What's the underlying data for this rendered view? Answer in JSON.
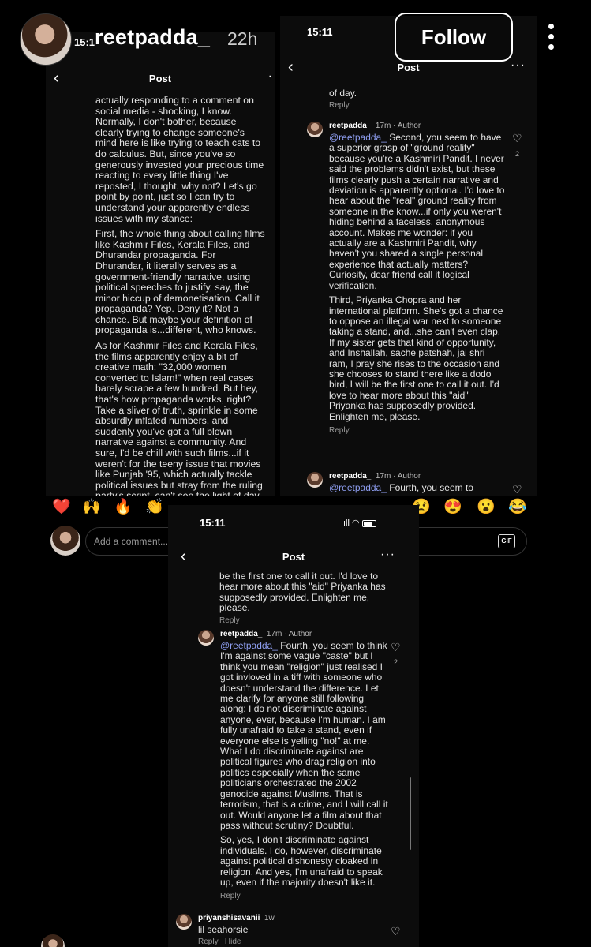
{
  "overlay": {
    "username": "reetpadda_",
    "time_ago": "22h",
    "follow_label": "Follow"
  },
  "screen1": {
    "time": "15:1",
    "nav_title": "Post",
    "paragraphs": [
      "actually responding to a comment on social media - shocking, I know. Normally, I don't bother, because clearly trying to change someone's mind here is like trying to teach cats to do calculus. But, since you've so generously invested your precious time reacting to every little thing I've reposted, I thought, why not? Let's go point by point, just so I can try to understand your apparently endless issues with my stance:",
      "First, the whole thing about calling films like Kashmir Files, Kerala Files, and Dhurandar propaganda. For Dhurandar, it literally serves as a government-friendly narrative, using political speeches to justify, say, the minor hiccup of demonetisation. Call it propaganda? Yep. Deny it? Not a chance. But maybe your definition of propaganda is...different, who knows.",
      "As for Kashmir Files and Kerala Files, the films apparently enjoy a bit of creative math: \"32,000 women converted to Islam!\" when real cases barely scrape a few hundred. But hey, that's how propaganda works, right? Take a sliver of truth, sprinkle in some absurdly inflated numbers, and suddenly you've got a full blown narrative against a community. And sure, I'd be chill with such films...if it weren't for the teeny issue that movies like Punjab '95, which actually tackle political issues but stray from the ruling party's script, can't see the light of day."
    ]
  },
  "screen2": {
    "time": "15:11",
    "nav_title": "Post",
    "top_fragment": "of day.",
    "reply_label": "Reply",
    "comment1": {
      "author": "reetpadda_",
      "meta": "17m · Author",
      "mention": "@reetpadda_",
      "like_count": "2",
      "paragraphs": [
        "Second, you seem to have a superior grasp of \"ground reality\" because you're a Kashmiri Pandit. I never said the problems didn't exist, but these films clearly push a certain narrative and deviation is apparently optional. I'd love to hear about the \"real\" ground reality from someone in the know...if only you weren't hiding behind a faceless, anonymous account. Makes me wonder: if you actually are a Kashmiri Pandit, why haven't you shared a single personal experience that actually matters? Curiosity, dear friend call it logical verification.",
        "Third, Priyanka Chopra and her international platform. She's got a chance to oppose an illegal war next to someone taking a stand, and...she can't even clap. If my sister gets that kind of opportunity, and Inshallah, sache patshah, jai shri ram, I pray she rises to the occasion and she chooses to stand there like a dodo bird, I will be the first one to call it out. I'd love to hear more about this \"aid\" Priyanka has supposedly provided. Enlighten me, please."
      ]
    },
    "comment2": {
      "author": "reetpadda_",
      "meta": "17m · Author",
      "mention": "@reetpadda_",
      "snippet": "Fourth, you seem to"
    }
  },
  "reactions": [
    "❤️",
    "🙌",
    "🔥",
    "👏",
    "😢",
    "😍",
    "😮",
    "😂"
  ],
  "comment_bar": {
    "placeholder": "Add a comment...",
    "gif_label": "GIF"
  },
  "screen3": {
    "time": "15:11",
    "nav_title": "Post",
    "top_fragment": "be the first one to call it out. I'd love to hear more about this \"aid\" Priyanka has supposedly provided. Enlighten me, please.",
    "reply_label": "Reply",
    "comment": {
      "author": "reetpadda_",
      "meta": "17m · Author",
      "mention": "@reetpadda_",
      "like_count": "2",
      "paragraphs": [
        "Fourth, you seem to think I'm against some vague \"caste\" but I think you mean \"religion\" just realised I got invloved in a tiff with someone who doesn't understand the difference. Let me clarify for anyone still following along: I do not discriminate against anyone, ever, because I'm human. I am fully unafraid to take a stand, even if everyone else is yelling \"no!\" at me. What I do discriminate against are political figures who drag religion into politics especially when the same politicians orchestrated the 2002 genocide against Muslims. That is terrorism, that is a crime, and I will call it out. Would anyone let a film about that pass without scrutiny? Doubtful.",
        "So, yes, I don't discriminate against individuals. I do, however, discriminate against political dishonesty cloaked in religion. And yes, I'm unafraid to speak up, even if the majority doesn't like it."
      ]
    },
    "other_comment": {
      "author": "priyanshisavanii",
      "meta": "1w",
      "text": "lil seahorsie",
      "actions": [
        "Reply",
        "Hide"
      ]
    }
  }
}
